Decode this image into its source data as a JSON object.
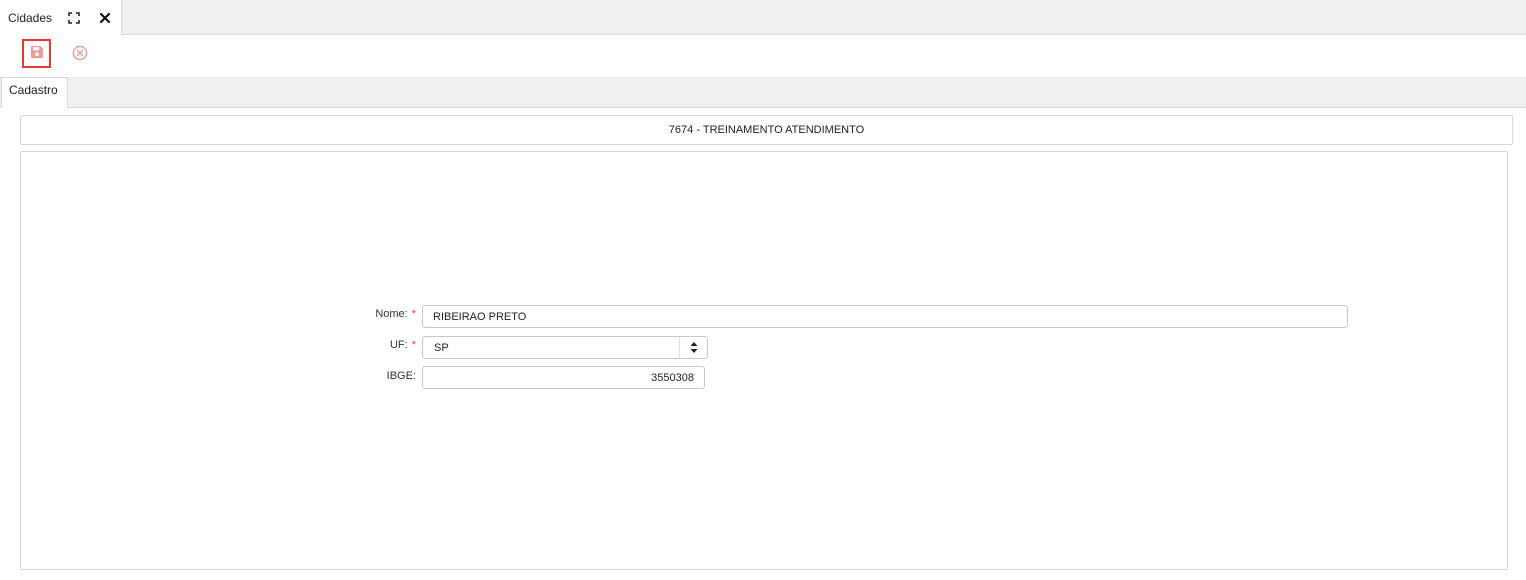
{
  "window_tab": {
    "label": "Cidades",
    "maximize_icon": "maximize-icon",
    "close_icon": "close-icon"
  },
  "toolbar": {
    "save_icon": "floppy-disk-icon",
    "cancel_icon": "circle-x-icon",
    "accent_color": "#e53935"
  },
  "inner_tabs": [
    {
      "label": "Cadastro",
      "active": true
    }
  ],
  "company_bar": {
    "text": "7674 - TREINAMENTO ATENDIMENTO"
  },
  "form": {
    "nome": {
      "label": "Nome:",
      "required_marker": "*",
      "value": "RIBEIRAO PRETO"
    },
    "uf": {
      "label": "UF:",
      "required_marker": "*",
      "selected": "SP"
    },
    "ibge": {
      "label": "IBGE:",
      "value": "3550308"
    }
  }
}
